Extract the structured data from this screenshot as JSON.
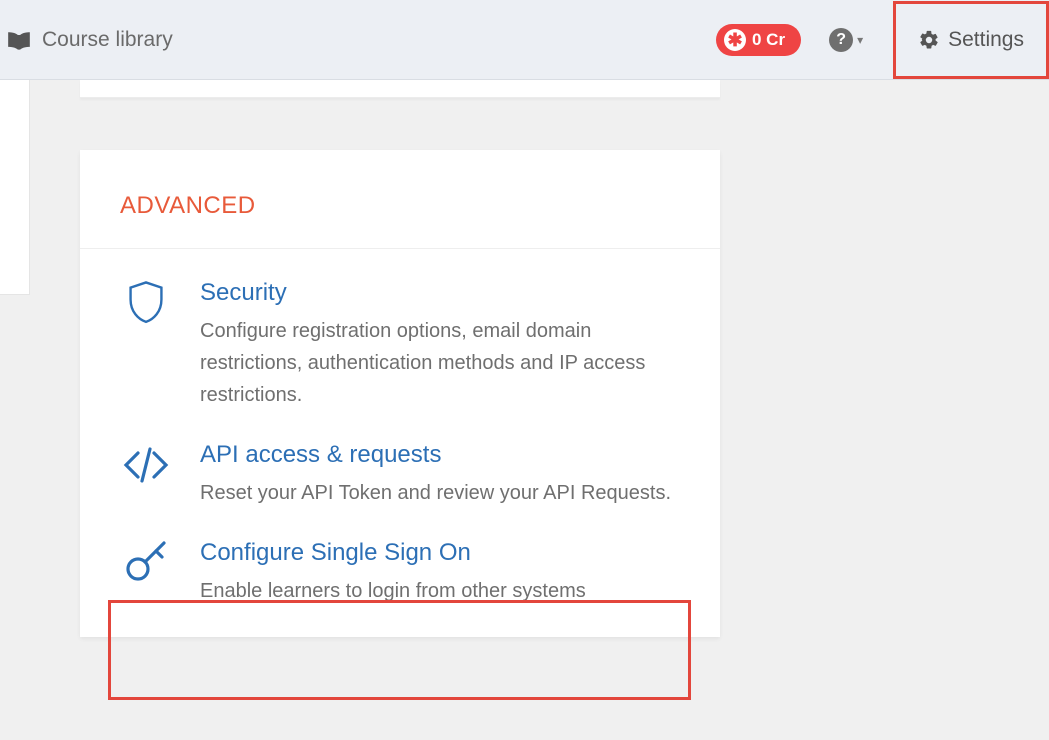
{
  "topbar": {
    "library_label": "Course library",
    "credits_text": "0 Cr",
    "settings_label": "Settings"
  },
  "panel": {
    "heading": "ADVANCED",
    "items": [
      {
        "title": "Security",
        "desc": "Configure registration options, email domain restrictions, authentication methods and IP access restrictions."
      },
      {
        "title": "API access & requests",
        "desc": "Reset your API Token and review your API Requests."
      },
      {
        "title": "Configure Single Sign On",
        "desc": "Enable learners to login from other systems"
      }
    ]
  }
}
